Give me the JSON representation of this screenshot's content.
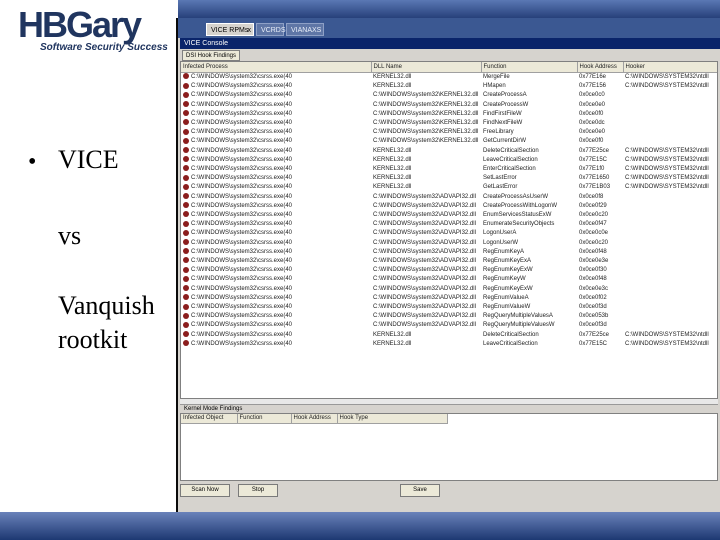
{
  "logo": {
    "main": "HBGary",
    "tagline": "Software Security Success"
  },
  "bullets": [
    {
      "bullet": "•",
      "text": "VICE"
    },
    {
      "bullet": "",
      "text": "vs"
    },
    {
      "bullet": "",
      "text": "Vanquish"
    },
    {
      "bullet": "",
      "text": "rootkit"
    }
  ],
  "colors": {
    "header_band": "#27407a",
    "footer": "#1d3872",
    "tab_bar": "#3b5892",
    "console_bar": "#0a246a",
    "process_icon": "#8b1e1e"
  },
  "app": {
    "tabs": [
      {
        "label": "VICE RPMs",
        "close": "x",
        "active": true
      },
      {
        "label": "VCRDS",
        "close": "",
        "active": false
      },
      {
        "label": "VIANAXS",
        "close": "",
        "active": false
      }
    ],
    "console_title": "VICE Console",
    "subtab": "DSI Hook Findings",
    "hooks_table": {
      "columns": [
        "Infected Process",
        "DLL Name",
        "Function",
        "Hook Address",
        "Hooker"
      ],
      "rows": [
        [
          "C:\\WINDOWS\\system32\\csrss.exe(40",
          "KERNEL32.dll",
          "MergeFile",
          "0x77E16e",
          "C:\\WINDOWS\\SYSTEM32\\ntdll"
        ],
        [
          "C:\\WINDOWS\\system32\\csrss.exe(40",
          "KERNEL32.dll",
          "HMapen",
          "0x77E156",
          "C:\\WINDOWS\\SYSTEM32\\ntdll"
        ],
        [
          "C:\\WINDOWS\\system32\\csrss.exe(40",
          "C:\\WINDOWS\\system32\\KERNEL32.dll",
          "CreateProcessA",
          "0x0ce0c0",
          ""
        ],
        [
          "C:\\WINDOWS\\system32\\csrss.exe(40",
          "C:\\WINDOWS\\system32\\KERNEL32.dll",
          "CreateProcessW",
          "0x0ce0e0",
          ""
        ],
        [
          "C:\\WINDOWS\\system32\\csrss.exe(40",
          "C:\\WINDOWS\\system32\\KERNEL32.dll",
          "FindFirstFileW",
          "0x0ce0f0",
          ""
        ],
        [
          "C:\\WINDOWS\\system32\\csrss.exe(40",
          "C:\\WINDOWS\\system32\\KERNEL32.dll",
          "FindNextFileW",
          "0x0ce0dc",
          ""
        ],
        [
          "C:\\WINDOWS\\system32\\csrss.exe(40",
          "C:\\WINDOWS\\system32\\KERNEL32.dll",
          "FreeLibrary",
          "0x0ce0e0",
          ""
        ],
        [
          "C:\\WINDOWS\\system32\\csrss.exe(40",
          "C:\\WINDOWS\\system32\\KERNEL32.dll",
          "GetCurrentDirW",
          "0x0ce0f0",
          ""
        ],
        [
          "C:\\WINDOWS\\system32\\csrss.exe(40",
          "KERNEL32.dll",
          "DeleteCriticalSection",
          "0x77E25ce",
          "C:\\WINDOWS\\SYSTEM32\\ntdll"
        ],
        [
          "C:\\WINDOWS\\system32\\csrss.exe(40",
          "KERNEL32.dll",
          "LeaveCriticalSection",
          "0x77E15C",
          "C:\\WINDOWS\\SYSTEM32\\ntdll"
        ],
        [
          "C:\\WINDOWS\\system32\\csrss.exe(40",
          "KERNEL32.dll",
          "EnterCriticalSection",
          "0x77E1f0",
          "C:\\WINDOWS\\SYSTEM32\\ntdll"
        ],
        [
          "C:\\WINDOWS\\system32\\csrss.exe(40",
          "KERNEL32.dll",
          "SetLastError",
          "0x77E1650",
          "C:\\WINDOWS\\SYSTEM32\\ntdll"
        ],
        [
          "C:\\WINDOWS\\system32\\csrss.exe(40",
          "KERNEL32.dll",
          "GetLastError",
          "0x77E1B03",
          "C:\\WINDOWS\\SYSTEM32\\ntdll"
        ],
        [
          "C:\\WINDOWS\\system32\\csrss.exe(40",
          "C:\\WINDOWS\\system32\\ADVAPI32.dll",
          "CreateProcessAsUserW",
          "0x0ce0f8",
          ""
        ],
        [
          "C:\\WINDOWS\\system32\\csrss.exe(40",
          "C:\\WINDOWS\\system32\\ADVAPI32.dll",
          "CreateProcessWithLogonW",
          "0x0ce0f29",
          ""
        ],
        [
          "C:\\WINDOWS\\system32\\csrss.exe(40",
          "C:\\WINDOWS\\system32\\ADVAPI32.dll",
          "EnumServicesStatusExW",
          "0x0ce0c20",
          ""
        ],
        [
          "C:\\WINDOWS\\system32\\csrss.exe(40",
          "C:\\WINDOWS\\system32\\ADVAPI32.dll",
          "EnumerateSecurityObjects",
          "0x0ce0f47",
          ""
        ],
        [
          "C:\\WINDOWS\\system32\\csrss.exe(40",
          "C:\\WINDOWS\\system32\\ADVAPI32.dll",
          "LogonUserA",
          "0x0ce0c0e",
          ""
        ],
        [
          "C:\\WINDOWS\\system32\\csrss.exe(40",
          "C:\\WINDOWS\\system32\\ADVAPI32.dll",
          "LogonUserW",
          "0x0ce0c20",
          ""
        ],
        [
          "C:\\WINDOWS\\system32\\csrss.exe(40",
          "C:\\WINDOWS\\system32\\ADVAPI32.dll",
          "RegEnumKeyA",
          "0x0ce0f48",
          ""
        ],
        [
          "C:\\WINDOWS\\system32\\csrss.exe(40",
          "C:\\WINDOWS\\system32\\ADVAPI32.dll",
          "RegEnumKeyExA",
          "0x0ce0e3e",
          ""
        ],
        [
          "C:\\WINDOWS\\system32\\csrss.exe(40",
          "C:\\WINDOWS\\system32\\ADVAPI32.dll",
          "RegEnumKeyExW",
          "0x0ce0f30",
          ""
        ],
        [
          "C:\\WINDOWS\\system32\\csrss.exe(40",
          "C:\\WINDOWS\\system32\\ADVAPI32.dll",
          "RegEnumKeyW",
          "0x0ce0f48",
          ""
        ],
        [
          "C:\\WINDOWS\\system32\\csrss.exe(40",
          "C:\\WINDOWS\\system32\\ADVAPI32.dll",
          "RegEnumKeyExW",
          "0x0ce0e3c",
          ""
        ],
        [
          "C:\\WINDOWS\\system32\\csrss.exe(40",
          "C:\\WINDOWS\\system32\\ADVAPI32.dll",
          "RegEnumValueA",
          "0x0ce0f02",
          ""
        ],
        [
          "C:\\WINDOWS\\system32\\csrss.exe(40",
          "C:\\WINDOWS\\system32\\ADVAPI32.dll",
          "RegEnumValueW",
          "0x0ce0f3d",
          ""
        ],
        [
          "C:\\WINDOWS\\system32\\csrss.exe(40",
          "C:\\WINDOWS\\system32\\ADVAPI32.dll",
          "RegQueryMultipleValuesA",
          "0x0ce053b",
          ""
        ],
        [
          "C:\\WINDOWS\\system32\\csrss.exe(40",
          "C:\\WINDOWS\\system32\\ADVAPI32.dll",
          "RegQueryMultipleValuesW",
          "0x0ce0f3d",
          ""
        ],
        [
          "C:\\WINDOWS\\system32\\csrss.exe(40",
          "KERNEL32.dll",
          "DeleteCriticalSection",
          "0x77E25ce",
          "C:\\WINDOWS\\SYSTEM32\\ntdll"
        ],
        [
          "C:\\WINDOWS\\system32\\csrss.exe(40",
          "KERNEL32.dll",
          "LeaveCriticalSection",
          "0x77E15C",
          "C:\\WINDOWS\\SYSTEM32\\ntdll"
        ]
      ]
    },
    "kernel_title": "Kernel Mode Findings",
    "kernel_table": {
      "columns": [
        "Infected Object",
        "Function",
        "Hook Address",
        "Hook Type"
      ]
    },
    "buttons": {
      "scan": "Scan Now",
      "stop": "Stop",
      "save": "Save"
    }
  }
}
